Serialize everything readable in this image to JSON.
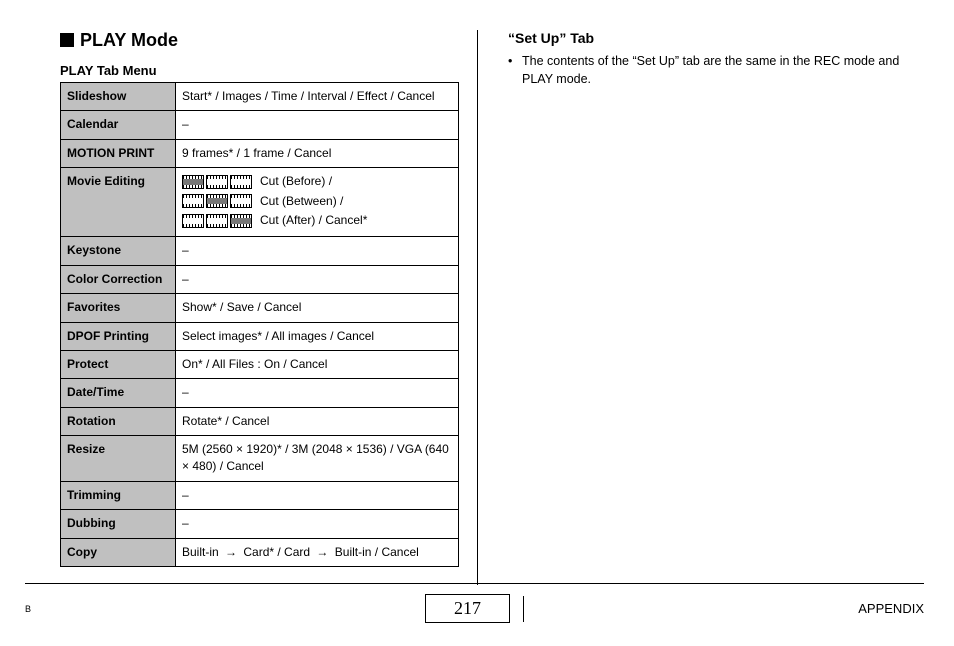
{
  "left": {
    "heading": "PLAY Mode",
    "subheading": "PLAY Tab Menu",
    "rows": {
      "slideshow": {
        "label": "Slideshow",
        "value": "Start* / Images / Time / Interval / Effect / Cancel"
      },
      "calendar": {
        "label": "Calendar",
        "value": "–"
      },
      "motionprint": {
        "label": "MOTION PRINT",
        "value": "9 frames* / 1 frame / Cancel"
      },
      "movieediting": {
        "label": "Movie Editing",
        "line1": "Cut (Before) /",
        "line2": "Cut (Between) /",
        "line3": "Cut (After) / Cancel*"
      },
      "keystone": {
        "label": "Keystone",
        "value": "–"
      },
      "colorcorr": {
        "label": "Color Correction",
        "value": "–"
      },
      "favorites": {
        "label": "Favorites",
        "value": "Show* / Save / Cancel"
      },
      "dpof": {
        "label": "DPOF Printing",
        "value": "Select images* / All images / Cancel"
      },
      "protect": {
        "label": "Protect",
        "value": "On* / All Files : On / Cancel"
      },
      "datetime": {
        "label": "Date/Time",
        "value": "–"
      },
      "rotation": {
        "label": "Rotation",
        "value": "Rotate* / Cancel"
      },
      "resize": {
        "label": "Resize",
        "value": "5M (2560 × 1920)* / 3M (2048 × 1536) / VGA (640 × 480) / Cancel"
      },
      "trimming": {
        "label": "Trimming",
        "value": "–"
      },
      "dubbing": {
        "label": "Dubbing",
        "value": "–"
      },
      "copy": {
        "label": "Copy",
        "part1": "Built-in",
        "part2": "Card* / Card",
        "part3": "Built-in / Cancel"
      }
    }
  },
  "right": {
    "heading": "“Set Up” Tab",
    "bullet": "The contents of the “Set Up” tab are the same in the REC mode and PLAY mode."
  },
  "footer": {
    "left": "B",
    "page": "217",
    "right": "APPENDIX"
  }
}
